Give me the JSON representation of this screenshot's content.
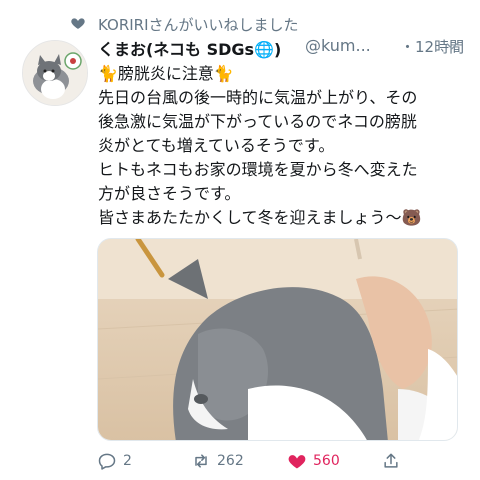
{
  "social_context": {
    "text": "KORIRIさんがいいねしました",
    "icon": "heart-icon"
  },
  "tweet": {
    "display_name": "くまお(ネコも SDGs🌐)",
    "handle": "@kum...",
    "timestamp": "・12時間",
    "text_lines": [
      "🐈膀胱炎に注意🐈",
      "先日の台風の後一時的に気温が上がり、その",
      "後急激に気温が下がっているのでネコの膀胱",
      "炎がとても増えているそうです。",
      "ヒトもネコもお家の環境を夏から冬へ変えた",
      "方が良さそうです。",
      "皆さまあたたかくして冬を迎えましょう〜🐻"
    ]
  },
  "actions": {
    "reply_count": "2",
    "retweet_count": "262",
    "like_count": "560"
  },
  "colors": {
    "like_pink": "#e0245e",
    "muted_text": "#657786"
  }
}
